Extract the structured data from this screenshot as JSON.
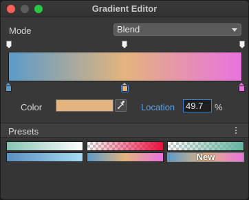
{
  "window": {
    "title": "Gradient Editor",
    "traffic_lights": {
      "close": "#fe5f57",
      "minimize": "#5c5c5c",
      "maximize": "#28c840"
    }
  },
  "mode": {
    "label": "Mode",
    "selected": "Blend"
  },
  "gradient": {
    "colors": [
      "#5b9bc9",
      "#e3b47e",
      "#e873df"
    ],
    "color_stops": [
      {
        "location": 0,
        "color": "#5b9bc9"
      },
      {
        "location": 49.7,
        "color": "#e3b47e",
        "selected": true
      },
      {
        "location": 100,
        "color": "#e873df"
      }
    ],
    "alpha_stops": [
      0,
      49.7,
      100
    ]
  },
  "editor": {
    "color_label": "Color",
    "color_value": "#e3b47e",
    "location_label": "Location",
    "location_value": "49.7",
    "location_unit": "%"
  },
  "presets": {
    "label": "Presets",
    "items": [
      {
        "name": "mint-to-white"
      },
      {
        "name": "transparent-to-red"
      },
      {
        "name": "transparent-to-teal"
      },
      {
        "name": "blue-to-light-blue"
      },
      {
        "name": "blue-peach-pink"
      },
      {
        "name": "new",
        "label": "New"
      }
    ]
  }
}
